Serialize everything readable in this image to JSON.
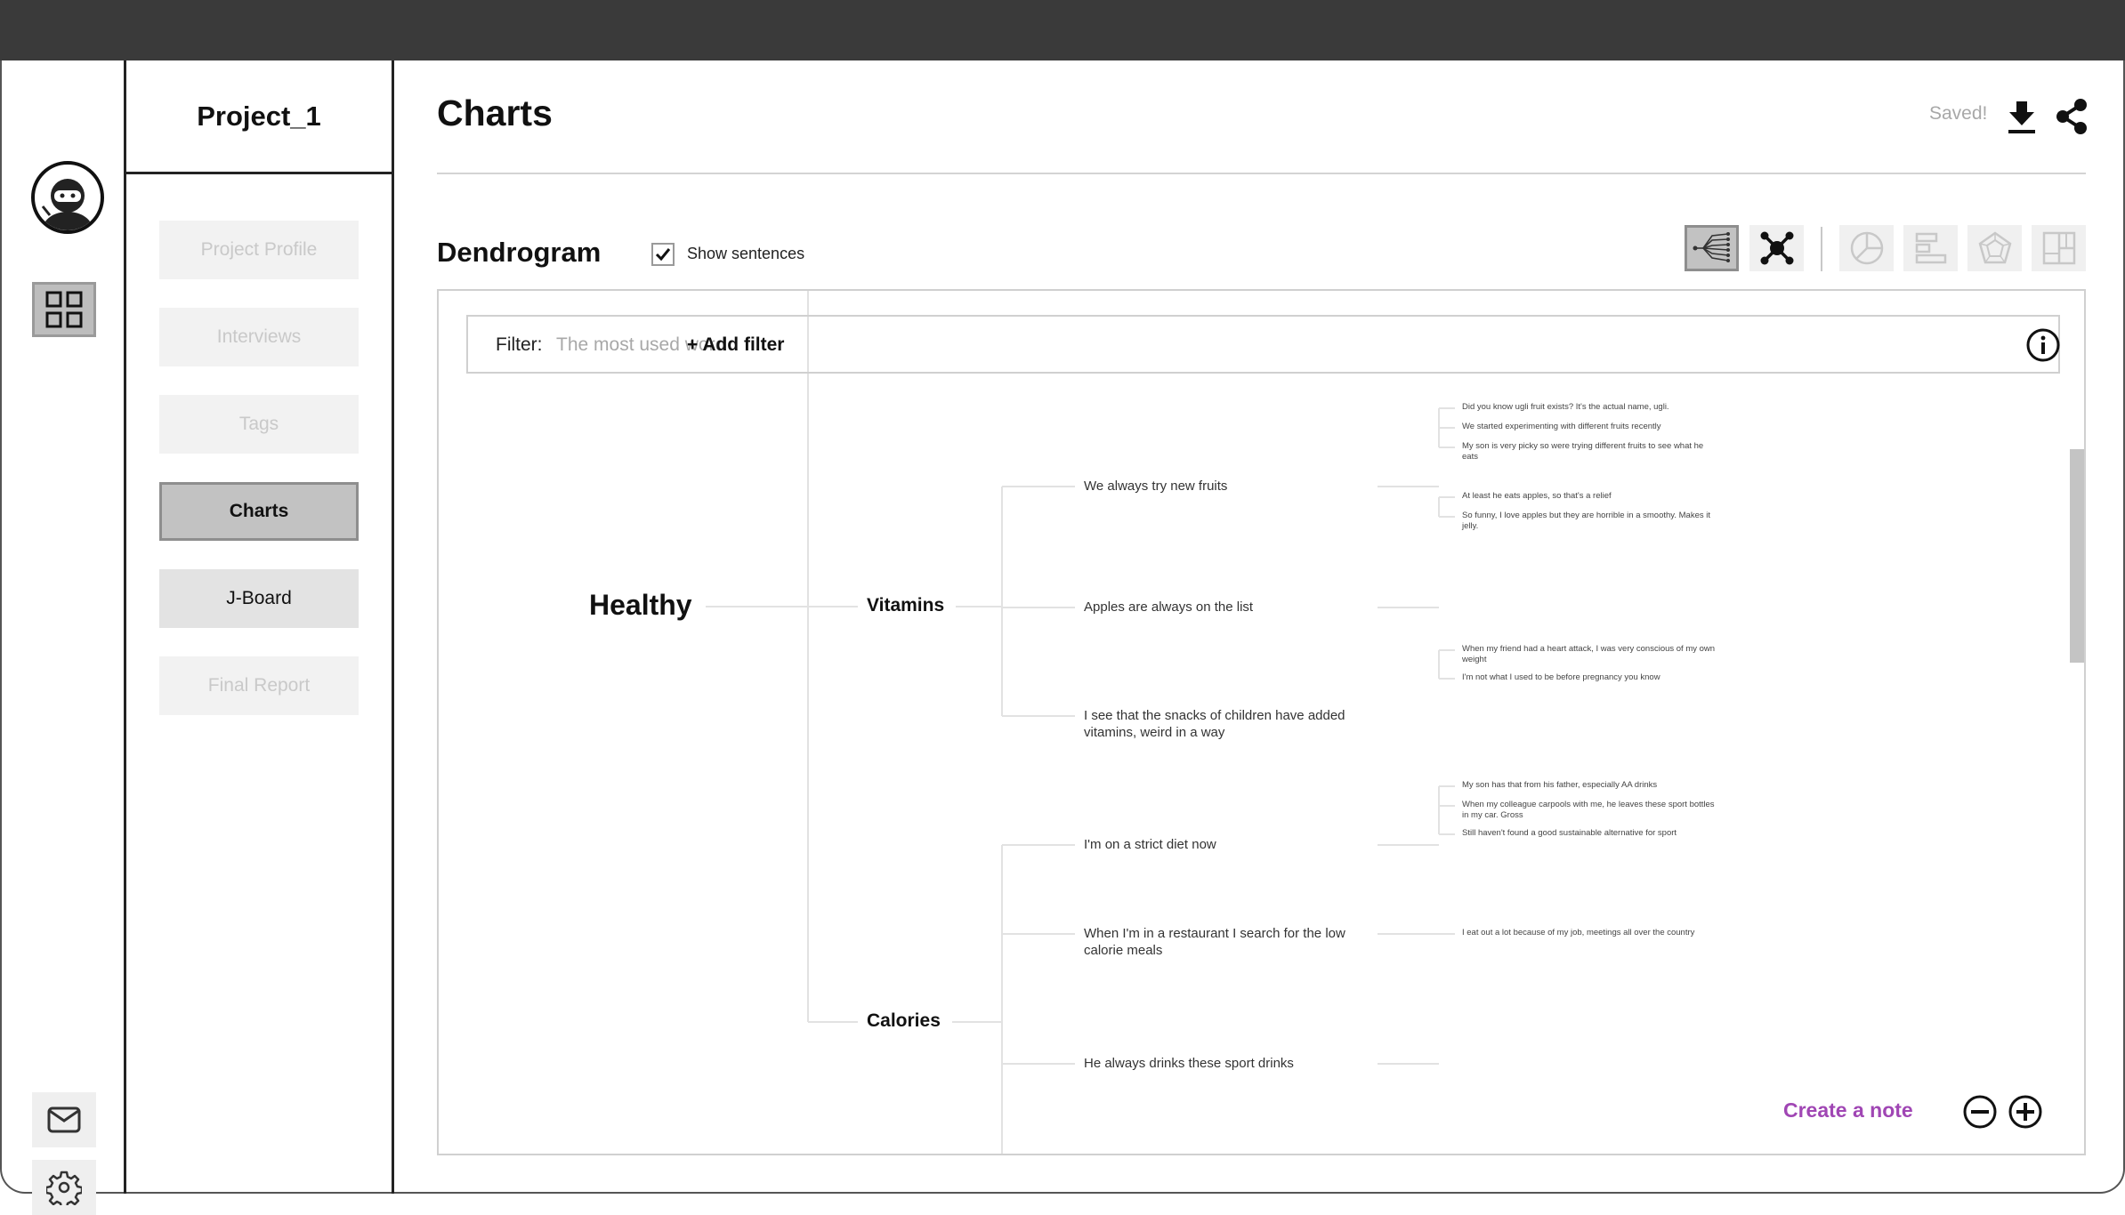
{
  "app": {
    "project_name": "Project_1"
  },
  "rail": {
    "avatar_icon": "ninja-avatar-icon",
    "items": [
      {
        "name": "dashboard",
        "icon": "grid-icon",
        "active": true
      },
      {
        "name": "mail",
        "icon": "mail-icon"
      },
      {
        "name": "settings",
        "icon": "gear-icon"
      }
    ]
  },
  "nav": {
    "items": [
      {
        "label": "Project Profile",
        "state": "disabled"
      },
      {
        "label": "Interviews",
        "state": "disabled"
      },
      {
        "label": "Tags",
        "state": "disabled"
      },
      {
        "label": "Charts",
        "state": "active"
      },
      {
        "label": "J-Board",
        "state": "enabled"
      },
      {
        "label": "Final Report",
        "state": "disabled"
      }
    ]
  },
  "header": {
    "title": "Charts",
    "status": "Saved!",
    "actions": [
      {
        "name": "download",
        "icon": "download-icon"
      },
      {
        "name": "share",
        "icon": "share-icon"
      }
    ]
  },
  "chart_section": {
    "title": "Dendrogram",
    "show_sentences": {
      "label": "Show sentences",
      "checked": true
    },
    "chart_types": [
      {
        "name": "dendrogram",
        "icon": "dendrogram-icon",
        "state": "active"
      },
      {
        "name": "network",
        "icon": "network-icon",
        "state": "enabled"
      },
      {
        "name": "pie",
        "icon": "pie-chart-icon",
        "state": "disabled"
      },
      {
        "name": "bar",
        "icon": "bar-chart-icon",
        "state": "disabled"
      },
      {
        "name": "radar",
        "icon": "radar-chart-icon",
        "state": "disabled"
      },
      {
        "name": "treemap",
        "icon": "treemap-icon",
        "state": "disabled"
      }
    ]
  },
  "filter": {
    "label": "Filter:",
    "value": "The most used word",
    "add_label": "+ Add filter",
    "info_icon": "info-icon"
  },
  "footer": {
    "create_note": "Create a note",
    "zoom_out_icon": "zoom-out-icon",
    "zoom_in_icon": "zoom-in-icon"
  },
  "colors": {
    "topbar": "#3a3a3a",
    "accent": "#a046b4",
    "active_bg": "#c2c2c2",
    "muted_text": "#a8a8a8"
  },
  "chart_data": {
    "type": "dendrogram",
    "title": "Dendrogram",
    "root": {
      "label": "Healthy",
      "children": [
        {
          "label": "Vitamins",
          "children": [
            {
              "label": "We always try new fruits",
              "children": [
                {
                  "label": "Did you know ugli fruit exists? It's the actual name, ugli."
                },
                {
                  "label": "We started experimenting with different fruits recently"
                },
                {
                  "label": "My son is very picky so were trying different fruits to see what he eats"
                }
              ]
            },
            {
              "label": "Apples are always on the list",
              "children": [
                {
                  "label": "At least he eats apples, so that's a relief"
                },
                {
                  "label": "So funny, I love apples but they are horrible in a smoothy. Makes it jelly."
                }
              ]
            },
            {
              "label": "I see that the snacks of children have added vitamins, weird in a way",
              "children": []
            }
          ]
        },
        {
          "label": "Calories",
          "children": [
            {
              "label": "I'm on a strict diet now",
              "children": [
                {
                  "label": "When my friend had a heart attack, I was very conscious of my own weight"
                },
                {
                  "label": "I'm not what I used to be before pregnancy you know"
                }
              ]
            },
            {
              "label": "When I'm in a restaurant I search for the low calorie meals",
              "children": [
                {
                  "label": "I eat out a lot because of my job, meetings all over the country"
                }
              ]
            },
            {
              "label": "He always drinks these sport drinks",
              "children": [
                {
                  "label": "My son has that from his father, especially AA drinks"
                },
                {
                  "label": "When my colleague carpools with me, he leaves these sport bottles in my car. Gross"
                },
                {
                  "label": "Still haven't found a good sustainable alternative for sport"
                }
              ]
            }
          ]
        }
      ]
    }
  }
}
